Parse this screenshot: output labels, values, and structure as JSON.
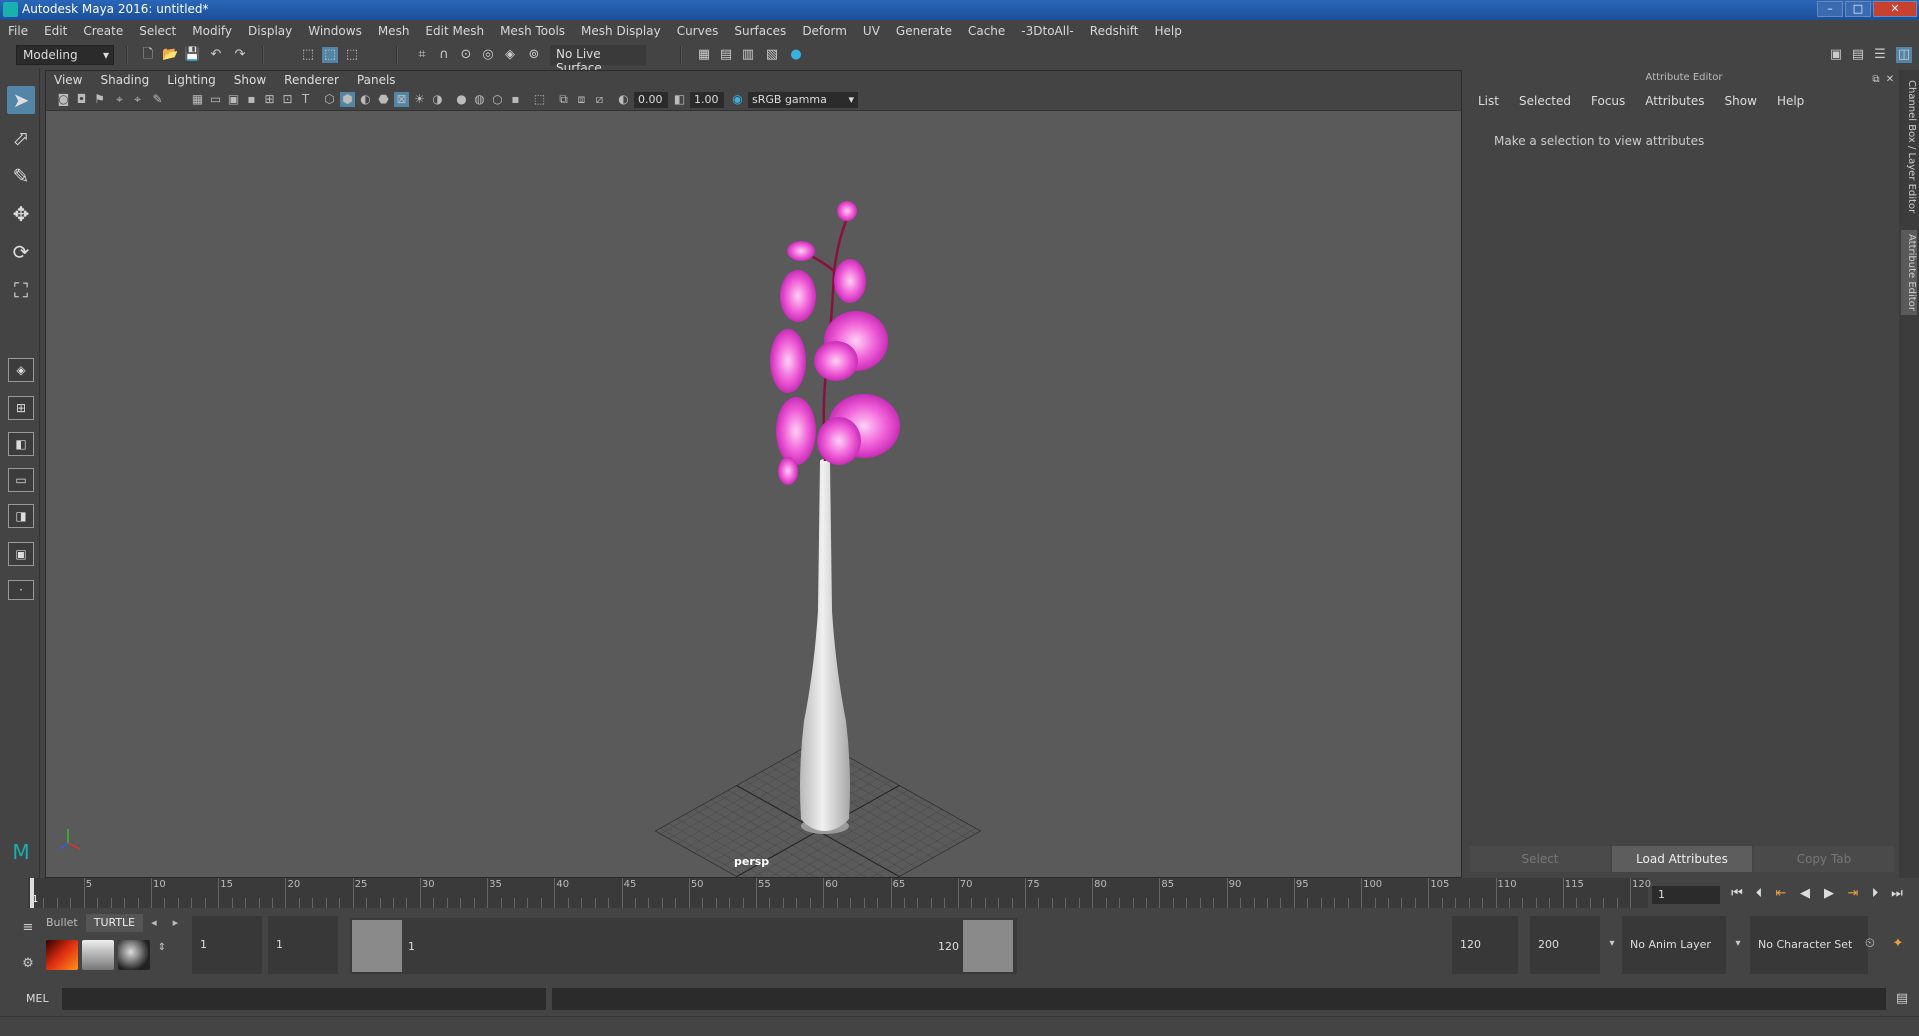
{
  "window": {
    "title": "Autodesk Maya 2016: untitled*",
    "min": "–",
    "max": "□",
    "close": "✕"
  },
  "menubar": [
    "File",
    "Edit",
    "Create",
    "Select",
    "Modify",
    "Display",
    "Windows",
    "Mesh",
    "Edit Mesh",
    "Mesh Tools",
    "Mesh Display",
    "Curves",
    "Surfaces",
    "Deform",
    "UV",
    "Generate",
    "Cache",
    "-3DtoAll-",
    "Redshift",
    "Help"
  ],
  "toolbar": {
    "mode": "Modeling",
    "live_surface": "No Live Surface"
  },
  "viewport": {
    "menu": [
      "View",
      "Shading",
      "Lighting",
      "Show",
      "Renderer",
      "Panels"
    ],
    "exposure": "0.00",
    "gamma": "1.00",
    "colorspace": "sRGB gamma",
    "camera_label": "persp"
  },
  "attribute_editor": {
    "title": "Attribute Editor",
    "menu": [
      "List",
      "Selected",
      "Focus",
      "Attributes",
      "Show",
      "Help"
    ],
    "message": "Make a selection to view attributes",
    "buttons": {
      "select": "Select",
      "load": "Load Attributes",
      "copy": "Copy Tab"
    },
    "side_tabs": [
      "Channel Box / Layer Editor",
      "Attribute Editor"
    ]
  },
  "timeslider": {
    "ticks": [
      "1",
      "5",
      "10",
      "15",
      "20",
      "25",
      "30",
      "35",
      "40",
      "45",
      "50",
      "55",
      "60",
      "65",
      "70",
      "75",
      "80",
      "85",
      "90",
      "95",
      "100",
      "105",
      "110",
      "115",
      "120"
    ],
    "current_frame": "1"
  },
  "range": {
    "start": "1",
    "playback_start": "1",
    "handle_start": "1",
    "handle_end": "120",
    "playback_end": "120",
    "end": "200",
    "anim_layer": "No Anim Layer",
    "character_set": "No Character Set"
  },
  "shelf": {
    "tabs": [
      "Bullet",
      "TURTLE"
    ]
  },
  "cmdline": {
    "label": "MEL"
  },
  "colors": {
    "accent": "#5285a6",
    "flower": "#e040c8",
    "vase": "#d0d0d0"
  }
}
